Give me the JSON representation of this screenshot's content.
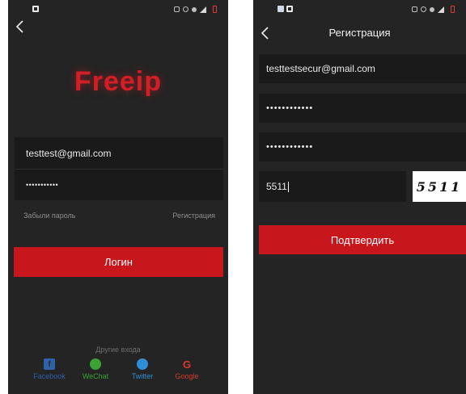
{
  "login_screen": {
    "logo": "Freeip",
    "email_value": "testtest@gmail.com",
    "password_value": "•••••••••••",
    "forgot_password": "Забыли пароль",
    "register_link": "Регистрация",
    "login_button": "Логин",
    "other_logins_label": "Другие входа",
    "socials": [
      {
        "label": "Facebook",
        "icon": "facebook-icon",
        "color": "#2f62a8"
      },
      {
        "label": "WeChat",
        "icon": "wechat-icon",
        "color": "#3aa235"
      },
      {
        "label": "Twitter",
        "icon": "twitter-icon",
        "color": "#2f8fd6"
      },
      {
        "label": "Google",
        "icon": "google-icon",
        "color": "#d83a2c"
      }
    ]
  },
  "register_screen": {
    "title": "Регистрация",
    "email_value": "testtestsecur@gmail.com",
    "password_value": "••••••••••••",
    "confirm_password_value": "••••••••••••",
    "captcha_input_value": "5511",
    "captcha_image_text": "5511",
    "confirm_button": "Подтвердить"
  },
  "colors": {
    "accent_red": "#c8161d",
    "background": "#242424",
    "field": "#1a1a1a"
  }
}
